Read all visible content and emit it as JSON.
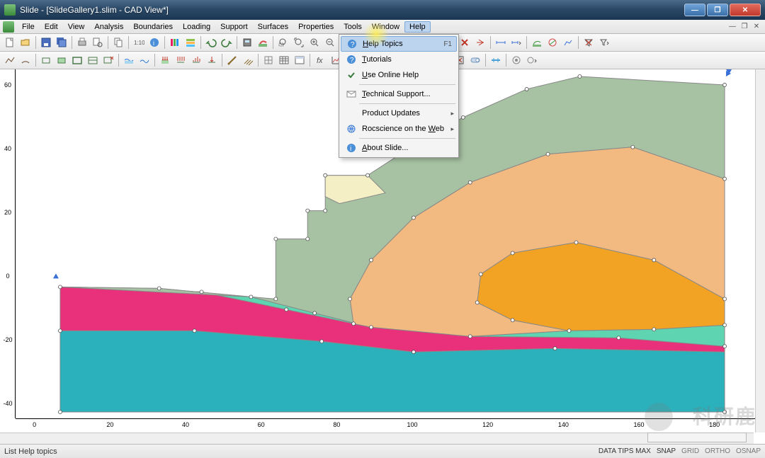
{
  "window": {
    "title": "Slide - [SlideGallery1.slim - CAD View*]",
    "minimize": "—",
    "maximize": "❐",
    "close": "✕"
  },
  "menubar": {
    "items": [
      "File",
      "Edit",
      "View",
      "Analysis",
      "Boundaries",
      "Loading",
      "Support",
      "Surfaces",
      "Properties",
      "Tools",
      "Window",
      "Help"
    ],
    "open_index": 11
  },
  "help_menu": {
    "items": [
      {
        "label": "Help Topics",
        "underline": "H",
        "shortcut": "F1",
        "icon": "help",
        "selected": true
      },
      {
        "label": "Tutorials",
        "underline": "T",
        "icon": "help"
      },
      {
        "label": "Use Online Help",
        "underline": "U",
        "icon": "check"
      },
      {
        "sep": true
      },
      {
        "label": "Technical Support...",
        "underline": "T",
        "icon": "mail"
      },
      {
        "sep": true
      },
      {
        "label": "Product Updates",
        "underline": "",
        "submenu": true
      },
      {
        "label": "Rocscience on the Web",
        "underline": "W",
        "icon": "globe",
        "submenu": true
      },
      {
        "sep": true
      },
      {
        "label": "About Slide...",
        "underline": "A",
        "icon": "info"
      }
    ]
  },
  "ruler_x": {
    "ticks": [
      0,
      20,
      40,
      60,
      80,
      100,
      120,
      140,
      160,
      180
    ]
  },
  "ruler_y": {
    "ticks": [
      -40,
      -20,
      0,
      20,
      40,
      60
    ]
  },
  "status": {
    "left": "List Help topics",
    "right": [
      "DATA TIPS MAX",
      "SNAP",
      "GRID",
      "ORTHO",
      "OSNAP"
    ],
    "right_active": [
      true,
      true,
      false,
      false,
      false
    ]
  },
  "watermark": "科研鹿"
}
